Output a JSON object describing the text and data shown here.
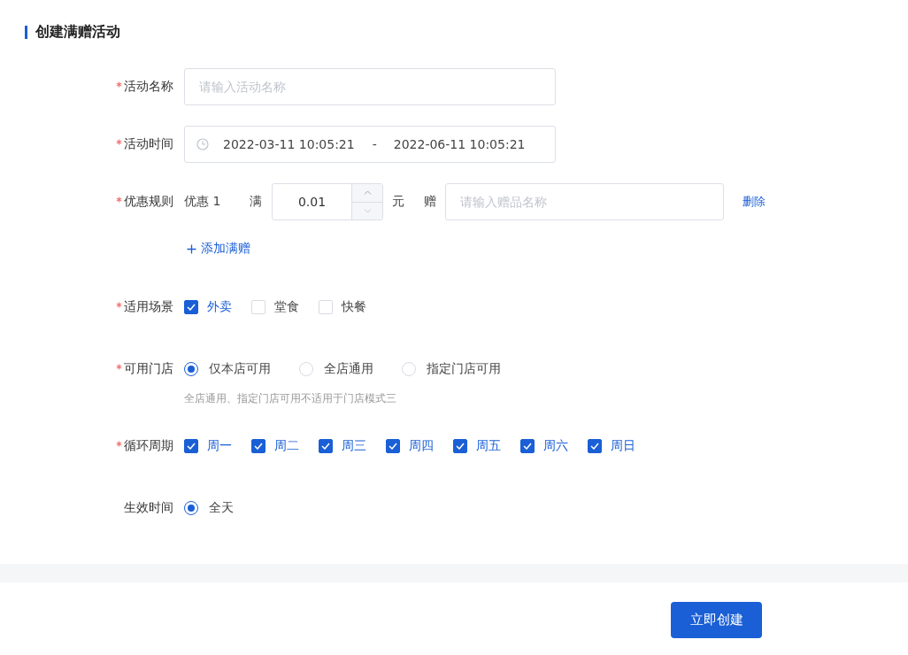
{
  "title": "创建满赠活动",
  "fields": [
    {
      "kind": "text",
      "label": "活动名称",
      "required": true,
      "placeholder": "请输入活动名称"
    },
    {
      "kind": "daterange",
      "label": "活动时间",
      "required": true,
      "start": "2022-03-11 10:05:21",
      "separator": "-",
      "end": "2022-06-11 10:05:21"
    },
    {
      "kind": "rules",
      "label": "优惠规则",
      "required": true,
      "rules": [
        {
          "name": "优惠 1",
          "threshold_label": "满",
          "amount": "0.01",
          "unit": "元",
          "gift_label": "赠",
          "gift_placeholder": "请输入赠品名称",
          "delete": "删除"
        }
      ],
      "add": "添加满赠"
    },
    {
      "kind": "checkboxes",
      "label": "适用场景",
      "required": true,
      "options": [
        {
          "label": "外卖",
          "checked": true
        },
        {
          "label": "堂食",
          "checked": false
        },
        {
          "label": "快餐",
          "checked": false
        }
      ]
    },
    {
      "kind": "radios",
      "label": "可用门店",
      "required": true,
      "options": [
        {
          "label": "仅本店可用",
          "selected": true
        },
        {
          "label": "全店通用",
          "selected": false
        },
        {
          "label": "指定门店可用",
          "selected": false
        }
      ],
      "hint": "全店通用、指定门店可用不适用于门店模式三"
    },
    {
      "kind": "checkboxes",
      "label": "循环周期",
      "required": true,
      "options": [
        {
          "label": "周一",
          "checked": true
        },
        {
          "label": "周二",
          "checked": true
        },
        {
          "label": "周三",
          "checked": true
        },
        {
          "label": "周四",
          "checked": true
        },
        {
          "label": "周五",
          "checked": true
        },
        {
          "label": "周六",
          "checked": true
        },
        {
          "label": "周日",
          "checked": true
        }
      ]
    },
    {
      "kind": "radios",
      "label": "生效时间",
      "required": false,
      "options": [
        {
          "label": "全天",
          "selected": true
        }
      ]
    }
  ],
  "submit": "立即创建"
}
